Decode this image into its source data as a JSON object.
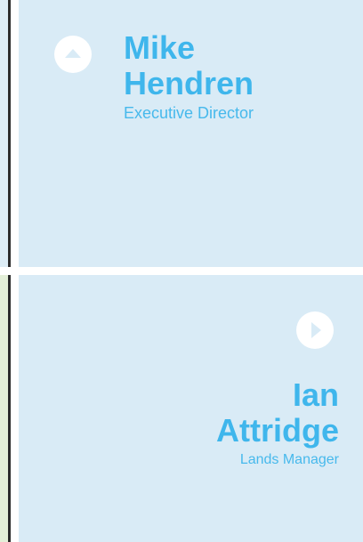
{
  "people": [
    {
      "first_name": "Mike",
      "last_name": "Hendren",
      "title": "Executive Director",
      "toggle_icon": "chevron-up-icon"
    },
    {
      "first_name": "Ian",
      "last_name": "Attridge",
      "title": "Lands Manager",
      "toggle_icon": "chevron-right-icon"
    }
  ],
  "colors": {
    "card_background": "#d9ebf6",
    "accent": "#3fb6ec",
    "side_strip_green": "#e3efd8"
  }
}
